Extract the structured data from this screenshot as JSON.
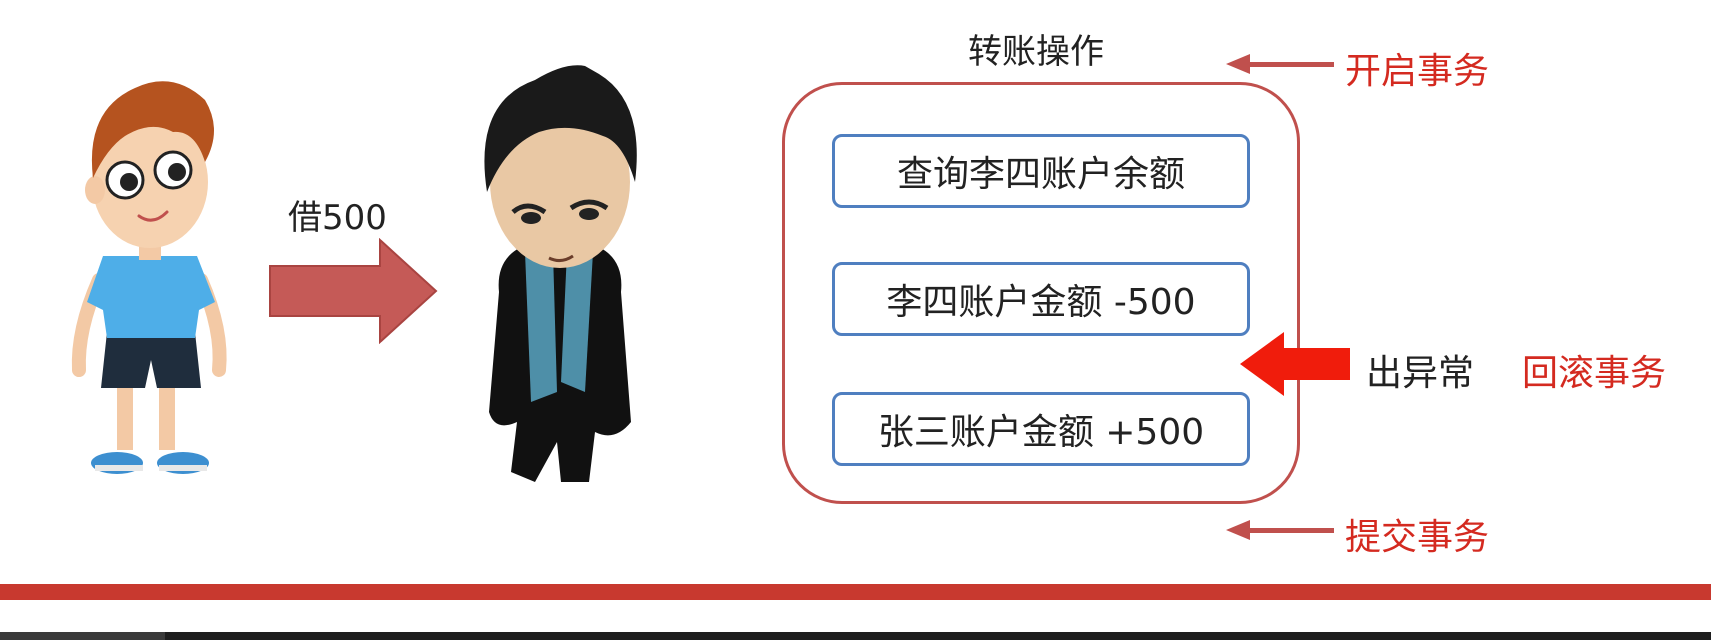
{
  "title": "转账操作",
  "borrow_label": "借500",
  "steps": [
    {
      "label": "查询李四账户余额"
    },
    {
      "label": "李四账户金额 -500"
    },
    {
      "label": "张三账户金额 +500"
    }
  ],
  "annotations": {
    "begin": "开启事务",
    "commit": "提交事务",
    "exception": "出异常",
    "rollback": "回滚事务"
  },
  "colors": {
    "frame": "#c0504d",
    "step_border": "#4f7fc0",
    "accent_red": "#d42a20",
    "exception_arrow": "#f01c0c",
    "bottom_bar": "#c8392f"
  },
  "icons": {
    "person_left": "boy-character-icon",
    "person_right": "man-in-black-coat-icon",
    "borrow_arrow": "right-arrow-icon"
  }
}
